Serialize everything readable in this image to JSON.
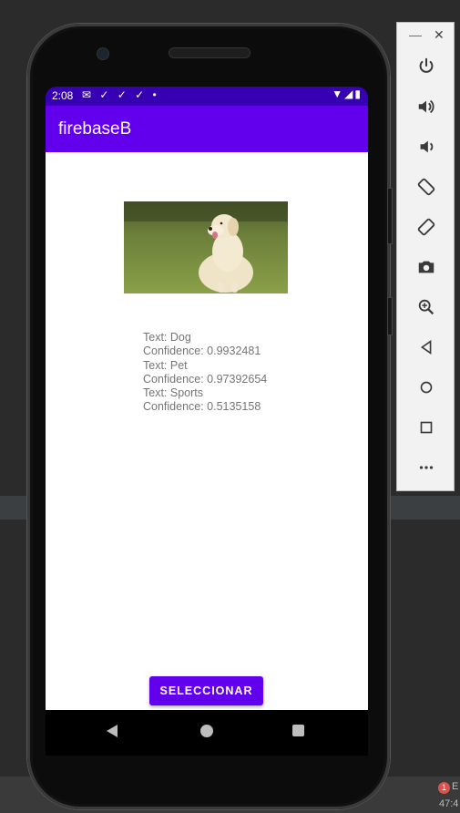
{
  "status_bar": {
    "time": "2:08",
    "icons_left": "✉ ✓ ✓ ✓ •",
    "icons_right": "▼◢▮"
  },
  "app_bar": {
    "title": "firebaseB"
  },
  "image": {
    "subject": "golden retriever sitting on grass"
  },
  "results": [
    {
      "text": "Text: Dog"
    },
    {
      "text": "Confidence: 0.9932481"
    },
    {
      "text": "Text: Pet"
    },
    {
      "text": "Confidence: 0.97392654"
    },
    {
      "text": "Text: Sports"
    },
    {
      "text": "Confidence: 0.5135158"
    }
  ],
  "select_button": {
    "label": "SELECCIONAR"
  },
  "colors": {
    "primary": "#6200ee",
    "primary_dark": "#3700b3"
  },
  "emulator_toolbar": {
    "buttons": [
      "power-icon",
      "volume-up-icon",
      "volume-down-icon",
      "rotate-left-icon",
      "rotate-right-icon",
      "camera-icon",
      "zoom-icon",
      "back-icon",
      "home-icon",
      "overview-icon",
      "more-icon"
    ]
  },
  "ide": {
    "error_count": "1",
    "error_label": "E",
    "clock": "47:4"
  }
}
